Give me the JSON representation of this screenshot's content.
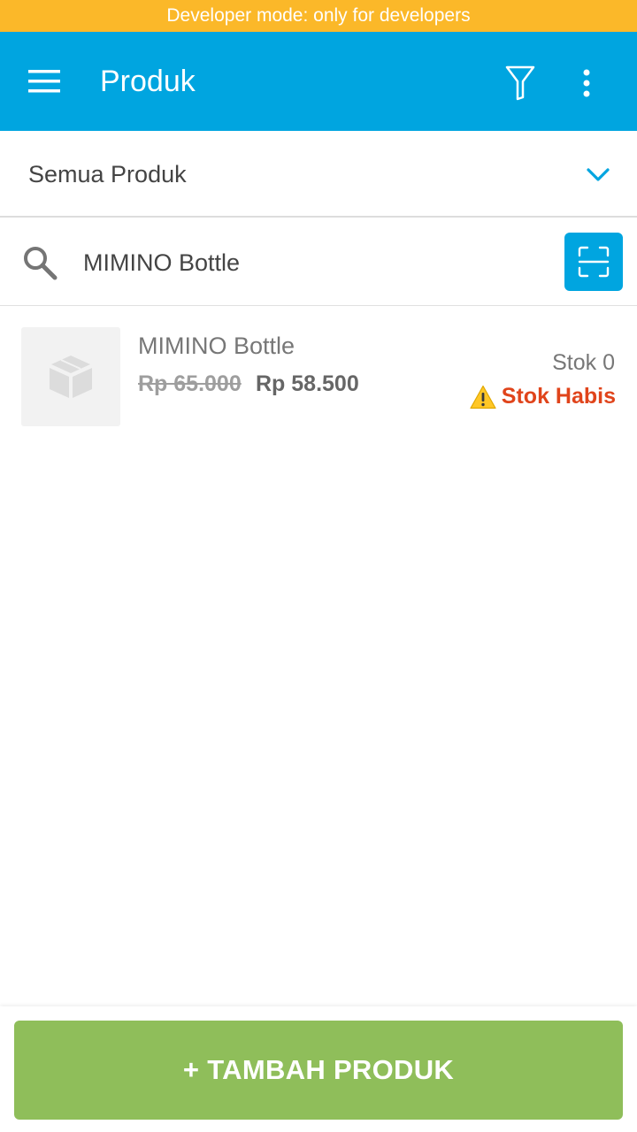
{
  "dev_banner": {
    "text": "Developer mode: only for developers"
  },
  "appbar": {
    "title": "Produk",
    "menu_icon": "hamburger-menu-icon",
    "filter_icon": "filter-funnel-icon",
    "more_icon": "more-vertical-icon"
  },
  "category": {
    "selected": "Semua Produk",
    "icon": "chevron-down-icon"
  },
  "search": {
    "value": "MIMINO Bottle",
    "icon": "search-icon",
    "scan_icon": "barcode-scan-icon"
  },
  "products": [
    {
      "name": "MIMINO Bottle",
      "price_original": "Rp 65.000",
      "price": "Rp 58.500",
      "stock": "Stok 0",
      "stock_status": "Stok Habis",
      "image_icon": "product-box-icon",
      "warning_icon": "warning-icon"
    }
  ],
  "footer": {
    "add_button": "+ TAMBAH PRODUK"
  },
  "colors": {
    "banner": "#FBB829",
    "primary": "#00A5E0",
    "add_button": "#8FBE5A",
    "out_of_stock": "#E0441B"
  }
}
